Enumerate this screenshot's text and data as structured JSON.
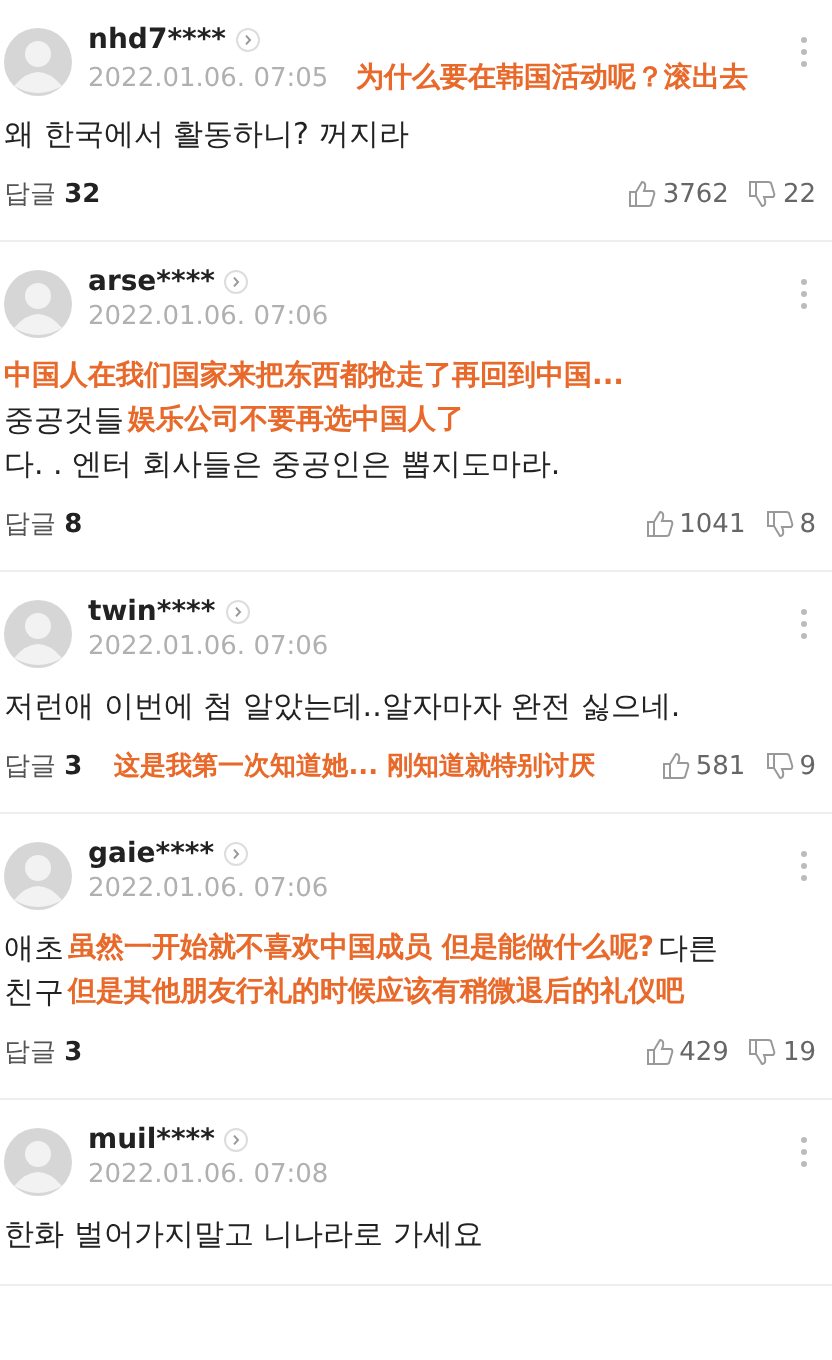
{
  "comments": [
    {
      "user": "nhd7****",
      "date": "2022.01.06. 07:05",
      "date_note": "为什么要在韩国活动呢？滚出去",
      "lines": [
        [
          {
            "kind": "text",
            "text": "왜 한국에서 활동하니? 꺼지라"
          }
        ]
      ],
      "footer": {
        "replies_label": "답글",
        "replies_count": "32",
        "likes": "3762",
        "dislikes": "22"
      }
    },
    {
      "user": "arse****",
      "date": "2022.01.06. 07:06",
      "lines": [
        [
          {
            "kind": "note",
            "text": "中国人在我们国家来把东西都抢走了再回到中国..."
          }
        ],
        [
          {
            "kind": "text",
            "text": "중공것들"
          },
          {
            "kind": "note",
            "text": "娱乐公司不要再选中国人了"
          }
        ],
        [
          {
            "kind": "text",
            "text": "다. . 엔터 회사들은 중공인은 뽑지도마라."
          }
        ]
      ],
      "footer": {
        "replies_label": "답글",
        "replies_count": "8",
        "likes": "1041",
        "dislikes": "8"
      }
    },
    {
      "user": "twin****",
      "date": "2022.01.06. 07:06",
      "lines": [
        [
          {
            "kind": "text",
            "text": "저런애 이번에 첨 알았는데..알자마자 완전 싫으네."
          }
        ]
      ],
      "footer": {
        "replies_label": "답글",
        "replies_count": "3",
        "note": "这是我第一次知道她... 刚知道就特别讨厌",
        "likes": "581",
        "dislikes": "9"
      }
    },
    {
      "user": "gaie****",
      "date": "2022.01.06. 07:06",
      "lines": [
        [
          {
            "kind": "text",
            "text": "애초"
          },
          {
            "kind": "note",
            "text": "虽然一开始就不喜欢中国成员 但是能做什么呢?"
          },
          {
            "kind": "text",
            "text": "다른"
          }
        ],
        [
          {
            "kind": "text",
            "text": "친구"
          },
          {
            "kind": "note",
            "text": "但是其他朋友行礼的时候应该有稍微退后的礼仪吧"
          }
        ]
      ],
      "footer": {
        "replies_label": "답글",
        "replies_count": "3",
        "likes": "429",
        "dislikes": "19"
      }
    },
    {
      "user": "muil****",
      "date": "2022.01.06. 07:08",
      "lines": [
        [
          {
            "kind": "text",
            "text": "한화 벌어가지말고 니나라로 가세요"
          }
        ]
      ]
    }
  ]
}
